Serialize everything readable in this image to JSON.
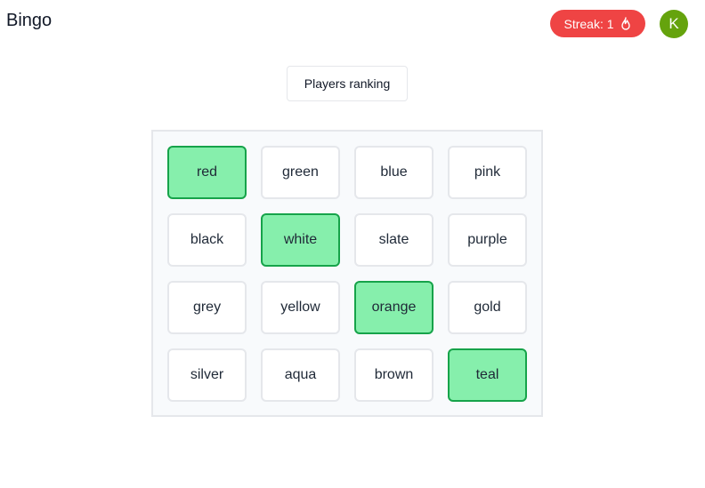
{
  "header": {
    "title": "Bingo",
    "streak_label": "Streak: 1",
    "streak_icon": "flame-icon",
    "avatar_initial": "K"
  },
  "ranking_button": {
    "label": "Players ranking"
  },
  "board": {
    "cells": [
      {
        "label": "red",
        "marked": true
      },
      {
        "label": "green",
        "marked": false
      },
      {
        "label": "blue",
        "marked": false
      },
      {
        "label": "pink",
        "marked": false
      },
      {
        "label": "black",
        "marked": false
      },
      {
        "label": "white",
        "marked": true
      },
      {
        "label": "slate",
        "marked": false
      },
      {
        "label": "purple",
        "marked": false
      },
      {
        "label": "grey",
        "marked": false
      },
      {
        "label": "yellow",
        "marked": false
      },
      {
        "label": "orange",
        "marked": true
      },
      {
        "label": "gold",
        "marked": false
      },
      {
        "label": "silver",
        "marked": false
      },
      {
        "label": "aqua",
        "marked": false
      },
      {
        "label": "brown",
        "marked": false
      },
      {
        "label": "teal",
        "marked": true
      }
    ]
  },
  "colors": {
    "streak_bg": "#ef4444",
    "avatar_bg": "#65a30d",
    "marked_bg": "#86efac",
    "marked_border": "#16a34a"
  }
}
